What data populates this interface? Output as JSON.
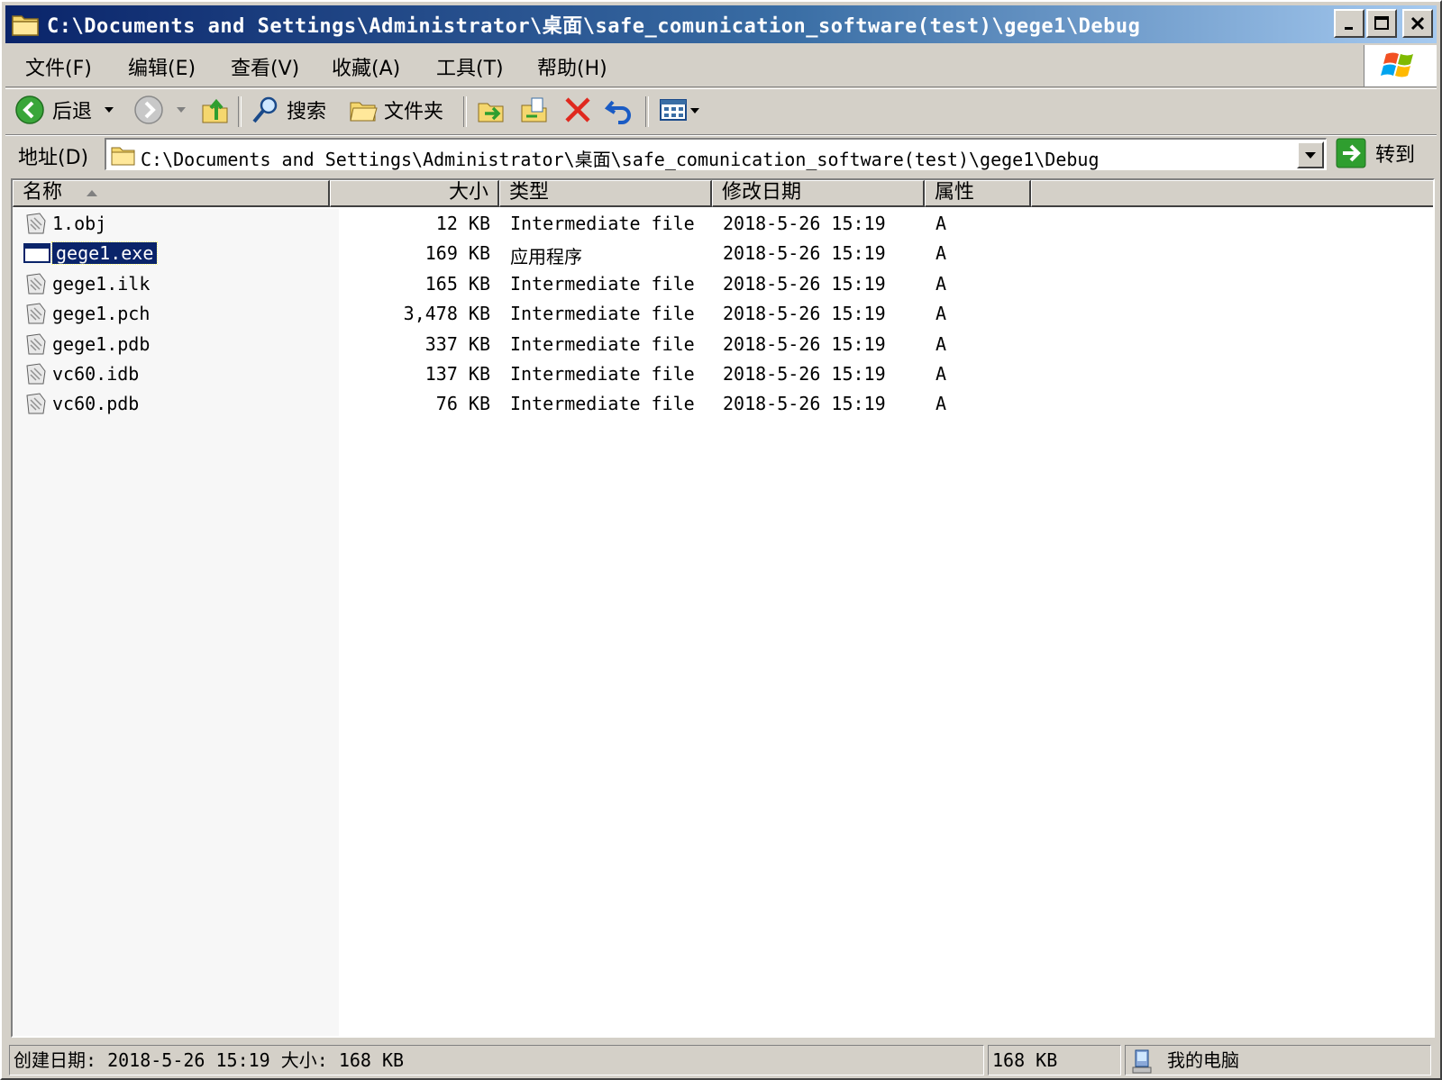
{
  "window": {
    "title": "C:\\Documents and Settings\\Administrator\\桌面\\safe_comunication_software(test)\\gege1\\Debug",
    "min_label": "_",
    "max_label": "□",
    "close_label": "✕"
  },
  "menu": [
    {
      "label": "文件(F)"
    },
    {
      "label": "编辑(E)"
    },
    {
      "label": "查看(V)"
    },
    {
      "label": "收藏(A)"
    },
    {
      "label": "工具(T)"
    },
    {
      "label": "帮助(H)"
    }
  ],
  "toolbar": {
    "back_label": "后退",
    "search_label": "搜索",
    "folders_label": "文件夹"
  },
  "address": {
    "label": "地址(D)",
    "value": "C:\\Documents and Settings\\Administrator\\桌面\\safe_comunication_software(test)\\gege1\\Debug",
    "go_label": "转到"
  },
  "columns": {
    "name": "名称",
    "size": "大小",
    "type": "类型",
    "modified": "修改日期",
    "attributes": "属性"
  },
  "files": [
    {
      "name": "1.obj",
      "size": "12 KB",
      "type": "Intermediate file",
      "modified": "2018-5-26 15:19",
      "attr": "A"
    },
    {
      "name": "gege1.exe",
      "size": "169 KB",
      "type": "应用程序",
      "modified": "2018-5-26 15:19",
      "attr": "A"
    },
    {
      "name": "gege1.ilk",
      "size": "165 KB",
      "type": "Intermediate file",
      "modified": "2018-5-26 15:19",
      "attr": "A"
    },
    {
      "name": "gege1.pch",
      "size": "3,478 KB",
      "type": "Intermediate file",
      "modified": "2018-5-26 15:19",
      "attr": "A"
    },
    {
      "name": "gege1.pdb",
      "size": "337 KB",
      "type": "Intermediate file",
      "modified": "2018-5-26 15:19",
      "attr": "A"
    },
    {
      "name": "vc60.idb",
      "size": "137 KB",
      "type": "Intermediate file",
      "modified": "2018-5-26 15:19",
      "attr": "A"
    },
    {
      "name": "vc60.pdb",
      "size": "76 KB",
      "type": "Intermediate file",
      "modified": "2018-5-26 15:19",
      "attr": "A"
    }
  ],
  "status": {
    "info": "创建日期: 2018-5-26 15:19 大小: 168 KB",
    "size": "168 KB",
    "zone": "我的电脑"
  },
  "colors": {
    "title_start": "#0a246a",
    "title_end": "#a6caf0",
    "selection": "#0a246a",
    "face": "#d4d0c8"
  }
}
